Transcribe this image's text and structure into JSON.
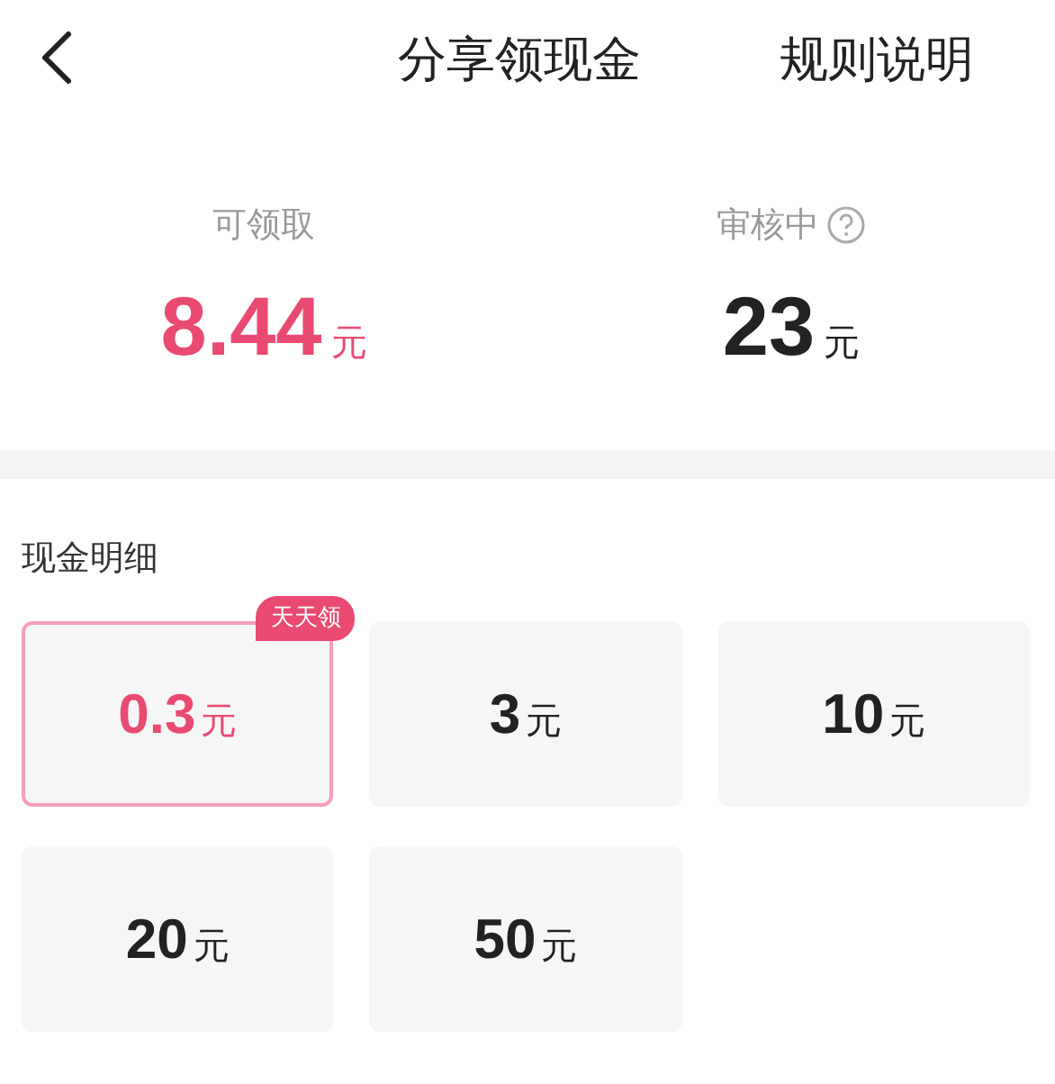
{
  "header": {
    "title": "分享领现金",
    "action": "规则说明"
  },
  "stats": [
    {
      "label": "可领取",
      "amount": "8.44",
      "unit": "元",
      "highlight": true,
      "help": false
    },
    {
      "label": "审核中",
      "amount": "23",
      "unit": "元",
      "highlight": false,
      "help": true
    }
  ],
  "section": {
    "title": "现金明细"
  },
  "options": [
    {
      "amount": "0.3",
      "unit": "元",
      "selected": true,
      "badge": "天天领"
    },
    {
      "amount": "3",
      "unit": "元",
      "selected": false
    },
    {
      "amount": "10",
      "unit": "元",
      "selected": false
    },
    {
      "amount": "20",
      "unit": "元",
      "selected": false
    },
    {
      "amount": "50",
      "unit": "元",
      "selected": false
    }
  ]
}
